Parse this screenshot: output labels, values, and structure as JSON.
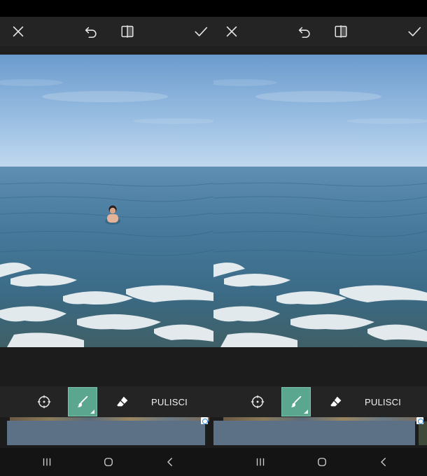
{
  "panels": [
    {
      "id": "before",
      "toolbar": {
        "close": "close-icon",
        "undo": "undo-icon",
        "compare": "compare-icon",
        "apply": "check-icon"
      },
      "tools": {
        "target": "crosshair-icon",
        "brush": "brush-icon",
        "eraser": "eraser-icon",
        "clear_label": "PULISCI"
      },
      "photo": {
        "swimmer_visible": true
      },
      "nav": {
        "recent": "recent-apps-icon",
        "home": "home-icon",
        "back": "back-icon"
      }
    },
    {
      "id": "after",
      "toolbar": {
        "close": "close-icon",
        "undo": "undo-icon",
        "compare": "compare-icon",
        "apply": "check-icon"
      },
      "tools": {
        "target": "crosshair-icon",
        "brush": "brush-icon",
        "eraser": "eraser-icon",
        "clear_label": "PULISCI"
      },
      "photo": {
        "swimmer_visible": false
      },
      "nav": {
        "recent": "recent-apps-icon",
        "home": "home-icon",
        "back": "back-icon"
      }
    }
  ],
  "colors": {
    "accent_brush": "#5aa68f",
    "toolbar_bg": "#242424",
    "ad_banner": "#5c7186",
    "sky_top": "#6f9fd0",
    "sea": "#3e6e8c"
  }
}
